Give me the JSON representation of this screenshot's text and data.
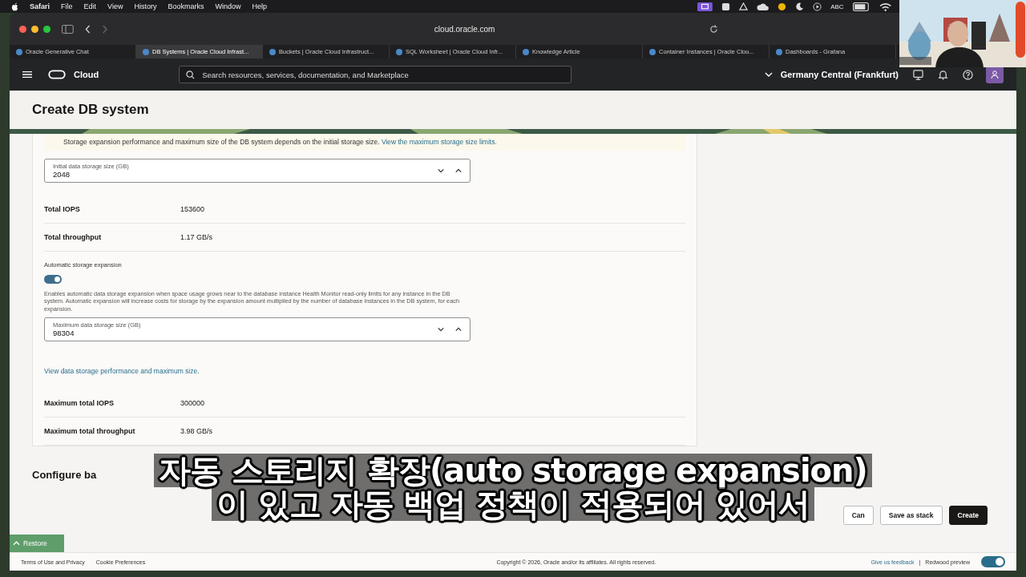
{
  "menu_bar": {
    "app": "Safari",
    "items": [
      "File",
      "Edit",
      "View",
      "History",
      "Bookmarks",
      "Window",
      "Help"
    ],
    "input_source": "ABC"
  },
  "browser": {
    "address": "cloud.oracle.com",
    "tabs": [
      {
        "label": "Oracle Generative Chat",
        "selected": false
      },
      {
        "label": "DB Systems | Oracle Cloud Infrast...",
        "selected": true
      },
      {
        "label": "Buckets | Oracle Cloud Infrastruct...",
        "selected": false
      },
      {
        "label": "SQL Worksheet | Oracle Cloud Infr...",
        "selected": false
      },
      {
        "label": "Knowledge Article",
        "selected": false
      },
      {
        "label": "Container Instances | Oracle Clou...",
        "selected": false
      },
      {
        "label": "Dashboards - Grafana",
        "selected": false
      }
    ]
  },
  "header": {
    "brand": "Cloud",
    "search": {
      "placeholder": "Search resources, services, documentation, and Marketplace"
    },
    "region": "Germany Central (Frankfurt)"
  },
  "page": {
    "title": "Create DB system",
    "notice": {
      "text": "Storage expansion performance and maximum size of the DB system depends on the initial storage size.",
      "link": "View the maximum storage size limits."
    },
    "items": [
      {
        "kind": "field",
        "label": "Initial data storage size (GB)",
        "value": "2048"
      },
      {
        "kind": "metric",
        "label": "Total IOPS",
        "value": "153600"
      },
      {
        "kind": "metric",
        "label": "Total throughput",
        "value": "1.17 GB/s"
      },
      {
        "kind": "toggle",
        "label": "Automatic storage expansion",
        "on": true,
        "help": "Enables automatic data storage expansion when space usage grows near to the database instance Health Monitor read-only limits for any instance in the DB system. Automatic expansion will increase costs for storage by the expansion amount multiplied by the number of database instances in the DB system, for each expansion."
      },
      {
        "kind": "field",
        "label": "Maximum data storage size (GB)",
        "value": "98304"
      },
      {
        "kind": "link",
        "text": "View data storage performance and maximum size."
      },
      {
        "kind": "metric",
        "label": "Maximum total IOPS",
        "value": "300000"
      },
      {
        "kind": "metric",
        "label": "Maximum total throughput",
        "value": "3.98 GB/s"
      }
    ],
    "next_section": "Configure ba",
    "actions": [
      {
        "label": "Can",
        "primary": false
      },
      {
        "label": "Save as stack",
        "primary": false
      },
      {
        "label": "Create",
        "primary": true
      }
    ],
    "restore": "Restore"
  },
  "footer": {
    "links": [
      "Terms of Use and Privacy",
      "Cookie Preferences"
    ],
    "copyright": "Copyright © 2026, Oracle and/or its affiliates. All rights reserved.",
    "feedback": "Give us feedback",
    "separator": "|",
    "preview": {
      "label": "Redwood preview",
      "on": true
    }
  },
  "subtitle": {
    "lines": [
      "자동 스토리지 확장(auto storage expansion)",
      "이 있고 자동 백업 정책이 적용되어 있어서"
    ]
  }
}
